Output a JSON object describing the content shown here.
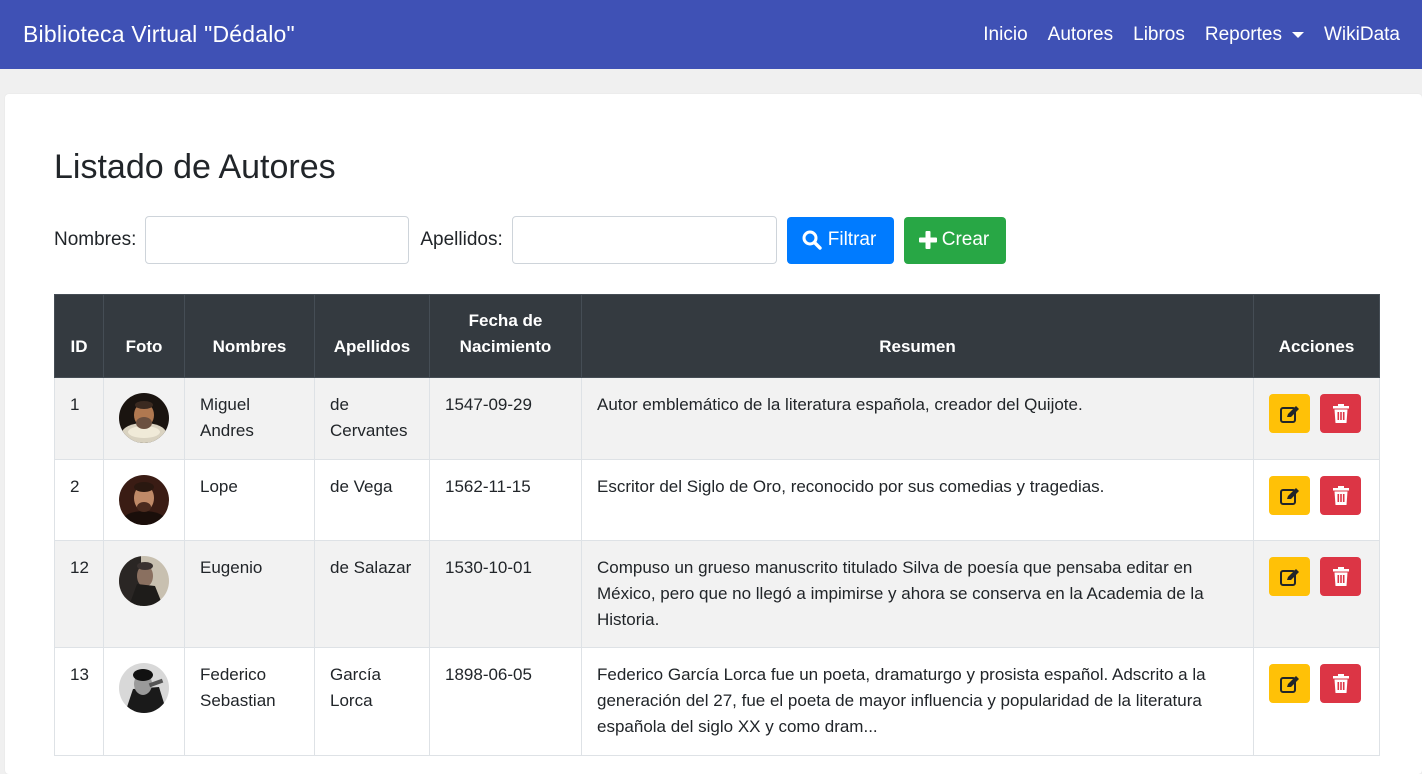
{
  "navbar": {
    "brand": "Biblioteca Virtual \"Dédalo\"",
    "links": [
      "Inicio",
      "Autores",
      "Libros",
      "Reportes",
      "WikiData"
    ]
  },
  "page": {
    "title": "Listado de Autores"
  },
  "filter": {
    "nombres_label": "Nombres:",
    "nombres_value": "",
    "apellidos_label": "Apellidos:",
    "apellidos_value": "",
    "filter_button": "Filtrar",
    "create_button": "Crear"
  },
  "table": {
    "headers": {
      "id": "ID",
      "foto": "Foto",
      "nombres": "Nombres",
      "apellidos": "Apellidos",
      "fecha_1": "Fecha de",
      "fecha_2": "Nacimiento",
      "resumen": "Resumen",
      "acciones": "Acciones"
    },
    "rows": [
      {
        "id": "1",
        "nombres": "Miguel Andres",
        "apellidos": "de Cervantes",
        "fecha": "1547-09-29",
        "resumen": "Autor emblemático de la literatura española, creador del Quijote."
      },
      {
        "id": "2",
        "nombres": "Lope",
        "apellidos": "de Vega",
        "fecha": "1562-11-15",
        "resumen": "Escritor del Siglo de Oro, reconocido por sus comedias y tragedias."
      },
      {
        "id": "12",
        "nombres": "Eugenio",
        "apellidos": "de Salazar",
        "fecha": "1530-10-01",
        "resumen": "Compuso un grueso manuscrito titulado Silva de poesía que pensaba editar en México, pero que no llegó a impimirse y ahora se conserva en la Academia de la Historia."
      },
      {
        "id": "13",
        "nombres": "Federico Sebastian",
        "apellidos": "García Lorca",
        "fecha": "1898-06-05",
        "resumen": "Federico García Lorca fue un poeta, dramaturgo y prosista español. Adscrito a la generación del 27, fue el poeta de mayor influencia y popularidad de la literatura española del siglo XX y como dram..."
      }
    ]
  },
  "colors": {
    "navbar": "#3f51b5",
    "primary": "#007bff",
    "success": "#28a745",
    "warning": "#ffc107",
    "danger": "#dc3545",
    "table_header": "#343a40"
  },
  "icons": {
    "filter": "search-icon",
    "create": "plus-icon",
    "edit": "edit-icon",
    "delete": "trash-icon",
    "dropdown": "caret-down-icon"
  }
}
